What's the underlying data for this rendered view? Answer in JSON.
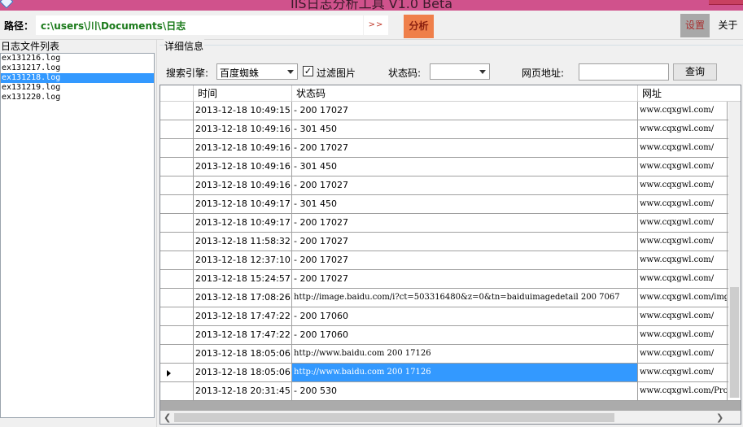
{
  "window": {
    "title": "IIS日志分析工具 V1.0 Beta"
  },
  "toolbar": {
    "path_label": "路径：",
    "path_value": "c:\\users\\川\\Documents\\日志",
    "browse_label": ">>",
    "analyze_label": "分析",
    "settings_label": "设置",
    "about_label": "关于"
  },
  "sidebar": {
    "title": "日志文件列表",
    "files": [
      "ex131216.log",
      "ex131217.log",
      "ex131218.log",
      "ex131219.log",
      "ex131220.log"
    ],
    "selected_index": 2
  },
  "details": {
    "group_title": "详细信息",
    "filters": {
      "engine_label": "搜索引擎:",
      "engine_value": "百度蜘蛛",
      "filter_images_label": "过滤图片",
      "filter_images_checked": true,
      "status_label": "状态码:",
      "status_value": "",
      "url_label": "网页地址:",
      "url_value": "",
      "query_label": "查询"
    },
    "columns": [
      "时间",
      "状态码",
      "网址"
    ],
    "rows": [
      {
        "time": "2013-12-18 10:49:15",
        "status": "- 200 17027",
        "url": "www.cqxgwl.com/"
      },
      {
        "time": "2013-12-18 10:49:16",
        "status": "- 301 450",
        "url": "www.cqxgwl.com/"
      },
      {
        "time": "2013-12-18 10:49:16",
        "status": "- 200 17027",
        "url": "www.cqxgwl.com/"
      },
      {
        "time": "2013-12-18 10:49:16",
        "status": "- 301 450",
        "url": "www.cqxgwl.com/"
      },
      {
        "time": "2013-12-18 10:49:16",
        "status": "- 200 17027",
        "url": "www.cqxgwl.com/"
      },
      {
        "time": "2013-12-18 10:49:17",
        "status": "- 301 450",
        "url": "www.cqxgwl.com/"
      },
      {
        "time": "2013-12-18 10:49:17",
        "status": "- 200 17027",
        "url": "www.cqxgwl.com/"
      },
      {
        "time": "2013-12-18 11:58:32",
        "status": "- 200 17027",
        "url": "www.cqxgwl.com/"
      },
      {
        "time": "2013-12-18 12:37:10",
        "status": "- 200 17027",
        "url": "www.cqxgwl.com/"
      },
      {
        "time": "2013-12-18 15:24:57",
        "status": "- 200 17027",
        "url": "www.cqxgwl.com/"
      },
      {
        "time": "2013-12-18 17:08:26",
        "status": "http://image.baidu.com/i?ct=503316480&z=0&tn=baiduimagedetail 200 7067",
        "url": "www.cqxgwl.com/img"
      },
      {
        "time": "2013-12-18 17:47:22",
        "status": "- 200 17060",
        "url": "www.cqxgwl.com/"
      },
      {
        "time": "2013-12-18 17:47:22",
        "status": "- 200 17060",
        "url": "www.cqxgwl.com/"
      },
      {
        "time": "2013-12-18 18:05:06",
        "status": "http://www.baidu.com 200 17126",
        "url": "www.cqxgwl.com/"
      },
      {
        "time": "2013-12-18 18:05:06",
        "status": "http://www.baidu.com 200 17126",
        "url": "www.cqxgwl.com/"
      },
      {
        "time": "2013-12-18 20:31:45",
        "status": "- 200 530",
        "url": "www.cqxgwl.com/Pro"
      }
    ],
    "selected_row": 14
  }
}
